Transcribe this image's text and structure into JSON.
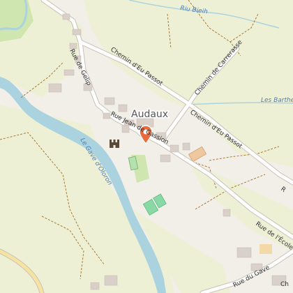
{
  "map": {
    "place": "Audaux",
    "water_labels": {
      "river_bieh": "Riu Bieih",
      "gave": "Le Gave d'Oloron",
      "barthes": "Les Barthe"
    },
    "road_labels": {
      "gelip": "Rue de Gelip",
      "eu_passot_north": "Chemin d'Eu Passot",
      "carrerasse": "Chemin de Carrerasse",
      "jean": "Rue Jean de Gassion",
      "eu_passot_south": "Chemin d'Eu Passot",
      "ecole": "Rue de l'École",
      "gave_rue": "Rue du Gave",
      "r_edge": "R",
      "ch_edge": "Ch"
    },
    "colors": {
      "background": "#f2efe9",
      "farmland": "#eef0d5",
      "meadow": "#cfe6b0",
      "water": "#aad3df",
      "building": "#d9d0c9",
      "road": "#ffffff",
      "road_casing": "#c8c2b8",
      "track": "#a87932",
      "marker": "#e96b3d"
    },
    "icons": [
      "location-pin-icon",
      "castle-icon"
    ]
  }
}
